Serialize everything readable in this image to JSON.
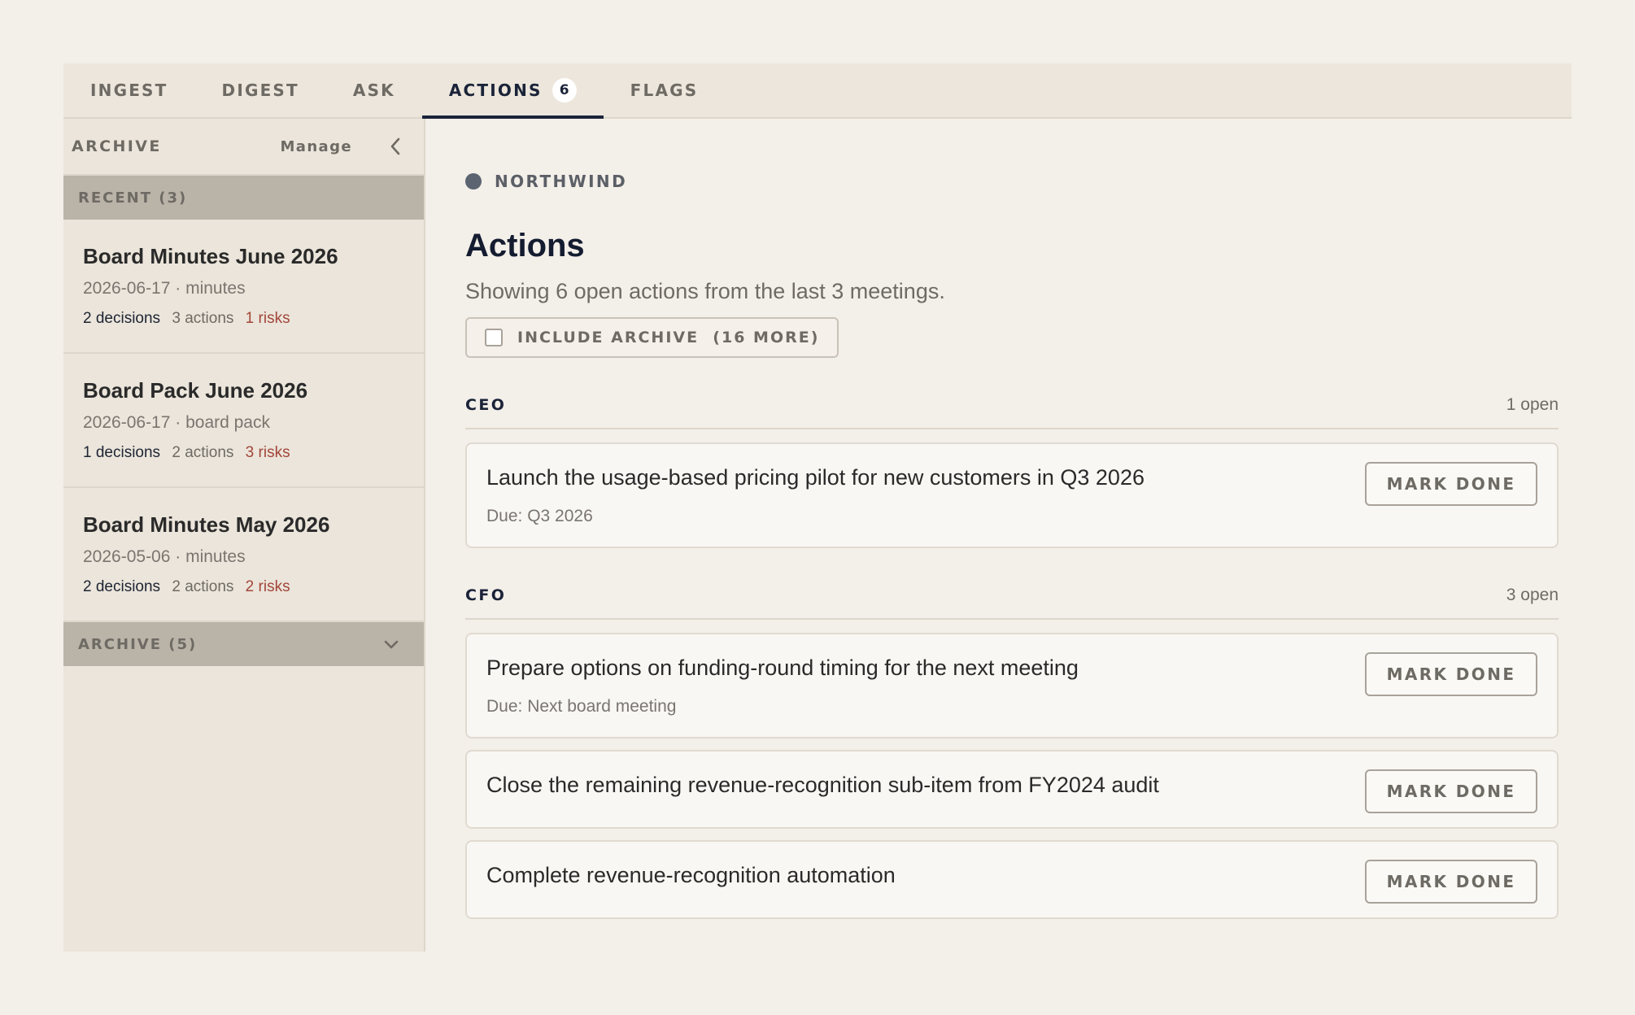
{
  "tabs": [
    {
      "label": "INGEST"
    },
    {
      "label": "DIGEST"
    },
    {
      "label": "ASK"
    },
    {
      "label": "ACTIONS",
      "count": "6",
      "active": true
    },
    {
      "label": "FLAGS"
    }
  ],
  "sidebar": {
    "title": "ARCHIVE",
    "manage_label": "Manage",
    "recent_group": "RECENT (3)",
    "archive_group": "ARCHIVE (5)",
    "docs": [
      {
        "title": "Board Minutes June 2026",
        "meta": "2026-06-17 · minutes",
        "decisions": "2 decisions",
        "actions": "3 actions",
        "risks": "1 risks"
      },
      {
        "title": "Board Pack June 2026",
        "meta": "2026-06-17 · board pack",
        "decisions": "1 decisions",
        "actions": "2 actions",
        "risks": "3 risks"
      },
      {
        "title": "Board Minutes May 2026",
        "meta": "2026-05-06 · minutes",
        "decisions": "2 decisions",
        "actions": "2 actions",
        "risks": "2 risks"
      }
    ]
  },
  "main": {
    "org": "NORTHWIND",
    "title": "Actions",
    "subtitle": "Showing 6 open actions from the last 3 meetings.",
    "include_archive": "INCLUDE ARCHIVE  (16 MORE)",
    "mark_done_label": "MARK DONE",
    "sections": [
      {
        "role": "CEO",
        "count": "1 open",
        "items": [
          {
            "text": "Launch the usage-based pricing pilot for new customers in Q3 2026",
            "due": "Due: Q3 2026"
          }
        ]
      },
      {
        "role": "CFO",
        "count": "3 open",
        "items": [
          {
            "text": "Prepare options on funding-round timing for the next meeting",
            "due": "Due: Next board meeting"
          },
          {
            "text": "Close the remaining revenue-recognition sub-item from FY2024 audit"
          },
          {
            "text": "Complete revenue-recognition automation"
          }
        ]
      }
    ]
  },
  "colors": {
    "background": "#f3efe9",
    "accent": "#1a2338",
    "risk": "#a3463a",
    "group_bar": "#bab3a8"
  },
  "icons": {
    "collapse": "chevron-left-icon",
    "expand": "chevron-down-icon",
    "org_dot": "status-dot-icon",
    "checkbox": "checkbox-icon"
  }
}
